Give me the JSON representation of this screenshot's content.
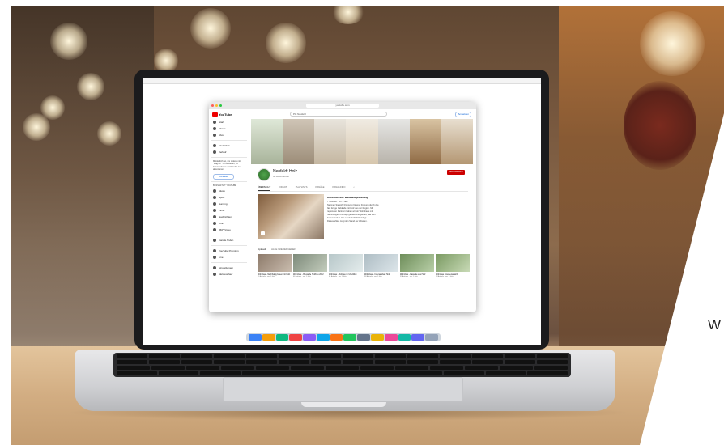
{
  "photo": {
    "description_icon": "laptop-photo"
  },
  "browser": {
    "address": "youtube.com",
    "search_query": "Pitt Neufeld"
  },
  "youtube": {
    "logo_text": "YouTube",
    "login_label": "Anmelden",
    "sidebar": {
      "items": [
        "Start",
        "Shorts",
        "Abos",
        "Mediathek",
        "Verlauf"
      ],
      "promo_text": "Melde dich an, um Videos mit \"Mag ich\" zu markieren, zu kommentieren und Kanäle zu abonnieren.",
      "promo_button": "Anmelden",
      "explore_heading": "BESSER MIT YOUTUBE",
      "explore_items": [
        "Musik",
        "Sport",
        "Gaming",
        "Filme",
        "Nachrichten",
        "Live",
        "360°-Video"
      ],
      "more_items": [
        "Kanäle finden",
        "YouTube Premium",
        "Live"
      ],
      "footer_items": [
        "Einstellungen",
        "Meldeverlauf"
      ]
    },
    "channel": {
      "name": "Neufeldt Holz",
      "subscribers": "30 Abonnenten",
      "subscribe_label": "ABONNIEREN",
      "tabs": [
        "ÜBERSICHT",
        "VIDEOS",
        "PLAYLISTS",
        "KANÄLE",
        "KANALINFO"
      ]
    },
    "featured": {
      "title": "Wohnbau Holz Waldrandgestaltung",
      "lines": [
        "77 Aufrufe · vor 1 Jahr",
        "Nehmen Sie sich 3 Minuten für eine Führung durch das",
        "fast fertige Gebäude mit Holz aus der Region. Mit",
        "regionalen Partnern haben wir ein Wohnhaus mit",
        "nachhaltigem Konzept geplant und gebaut, das sich",
        "harmonisch in das Landschaftsbild einfügt.",
        "Dieses Video zeigt den Stand der Arbeiten."
      ]
    },
    "uploads": {
      "label": "Uploads",
      "play_all": "ALLE WIEDERGEBEN",
      "videos": [
        {
          "title": "Wohnbau - Nachhaltig bauen mit Holz",
          "meta": "55 Aufrufe · vor 1 Jahr"
        },
        {
          "title": "Wohnbau - Baustelle Holzbau 2022",
          "meta": "46 Aufrufe · vor 1 Jahr"
        },
        {
          "title": "Wohnbau - Rohbau im Überblick",
          "meta": "41 Aufrufe · vor 1 Jahr"
        },
        {
          "title": "Wohnbau - Innenausbau Holz",
          "meta": "38 Aufrufe · vor 1 Jahr"
        },
        {
          "title": "Wohnbau - Fassade aus Holz",
          "meta": "33 Aufrufe · vor 1 Jahr"
        },
        {
          "title": "Wohnbau - Aussenansicht",
          "meta": "29 Aufrufe · vor 1 Jahr"
        }
      ]
    }
  },
  "side_text": "W",
  "colors": {
    "youtube_red": "#e00000",
    "link_blue": "#065fd4",
    "laptop_dark": "#1b1b1d",
    "wood_table": "#d2ad82"
  }
}
